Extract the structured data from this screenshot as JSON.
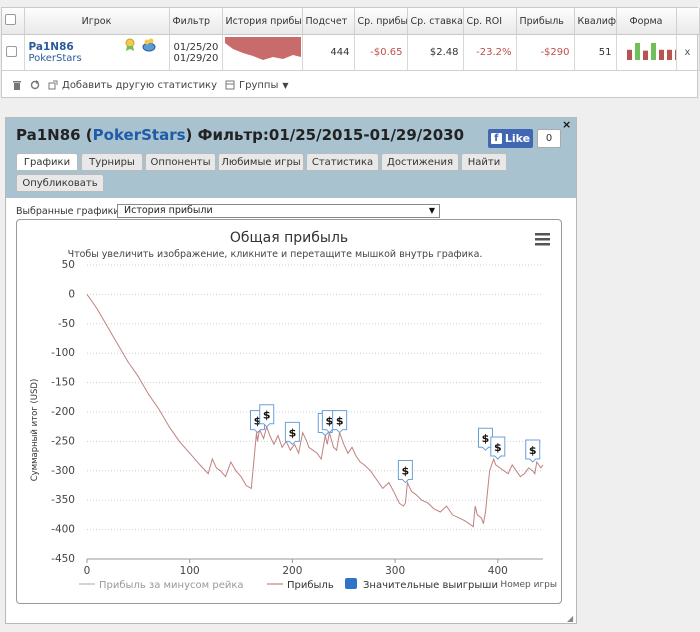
{
  "stats_table": {
    "headers": [
      "Игрок",
      "Фильтр",
      "История прибы",
      "Подсчет",
      "Ср. прибы",
      "Ср. ставка",
      "Ср. ROI",
      "Прибыль",
      "Квалиф",
      "Форма"
    ],
    "row": {
      "player": "Pa1N86",
      "site": "PokerStars",
      "filter_line1": "01/25/20",
      "filter_line2": "01/29/20",
      "count": "444",
      "avg_profit": "-$0.65",
      "avg_stake": "$2.48",
      "avg_roi": "-23.2%",
      "profit": "-$290",
      "qualification": "51",
      "remove": "x"
    },
    "form_bars": [
      {
        "value": 0.6,
        "color": "#b85450"
      },
      {
        "value": 1.0,
        "color": "#6fbf5a"
      },
      {
        "value": 0.55,
        "color": "#b85450"
      },
      {
        "value": 1.0,
        "color": "#6fbf5a"
      },
      {
        "value": 0.6,
        "color": "#b85450"
      },
      {
        "value": 0.6,
        "color": "#b85450"
      },
      {
        "value": 0.6,
        "color": "#b85450"
      }
    ]
  },
  "toolbar": {
    "add_stat_label": "Добавить другую статистику",
    "groups_label": "Группы"
  },
  "panel": {
    "player": "Pa1N86",
    "site": "PokerStars",
    "filter_text": "Фильтр:01/25/2015-01/29/2030",
    "fb_like_label": "Like",
    "fb_count": "0",
    "close_label": "×",
    "tabs": [
      "Графики",
      "Турниры",
      "Оппоненты",
      "Любимые игры",
      "Статистика",
      "Достижения",
      "Найти",
      "Опубликовать"
    ],
    "select_label": "Выбранные графики:",
    "select_value": "История прибыли"
  },
  "colors": {
    "profit_line": "#c0817f",
    "rake_line": "#bbbbbb",
    "big_wins": "#2e75c7",
    "header_bg": "#a8c3cf"
  },
  "chart_data": {
    "type": "line",
    "title": "Общая прибыль",
    "subtitle": "Чтобы увеличить изображение, кликните и перетащите мышкой внутрь графика.",
    "ylabel": "Суммарный итог (USD)",
    "xlabel": "Номер игры",
    "xlim": [
      0,
      444
    ],
    "ylim": [
      -450,
      50
    ],
    "x_ticks": [
      0,
      100,
      200,
      300,
      400
    ],
    "y_ticks": [
      50,
      0,
      -50,
      -100,
      -150,
      -200,
      -250,
      -300,
      -350,
      -400,
      -450
    ],
    "legend": [
      "Прибыль за минусом рейка",
      "Прибыль",
      "Значительные выигрыши"
    ],
    "legend_placement": "bottom",
    "series": [
      {
        "name": "Прибыль",
        "x": [
          0,
          5,
          10,
          20,
          30,
          40,
          50,
          60,
          70,
          80,
          90,
          100,
          110,
          118,
          122,
          126,
          130,
          135,
          140,
          145,
          150,
          155,
          160,
          165,
          166,
          168,
          172,
          175,
          178,
          182,
          186,
          190,
          194,
          198,
          202,
          206,
          210,
          214,
          216,
          220,
          224,
          228,
          232,
          234,
          236,
          240,
          243,
          246,
          250,
          254,
          258,
          262,
          266,
          270,
          276,
          282,
          288,
          294,
          300,
          304,
          308,
          310,
          312,
          316,
          320,
          326,
          332,
          338,
          344,
          350,
          356,
          362,
          368,
          372,
          376,
          378,
          380,
          384,
          386,
          388,
          392,
          396,
          398,
          402,
          406,
          410,
          414,
          418,
          422,
          426,
          430,
          434,
          436,
          438,
          442,
          444
        ],
        "y": [
          0,
          -12,
          -25,
          -55,
          -85,
          -115,
          -140,
          -170,
          -195,
          -225,
          -250,
          -270,
          -290,
          -305,
          -280,
          -295,
          -300,
          -310,
          -285,
          -300,
          -310,
          -325,
          -330,
          -235,
          -250,
          -230,
          -245,
          -225,
          -240,
          -255,
          -240,
          -260,
          -250,
          -265,
          -255,
          -270,
          -235,
          -250,
          -260,
          -265,
          -270,
          -280,
          -240,
          -255,
          -235,
          -260,
          -265,
          -235,
          -255,
          -270,
          -260,
          -275,
          -285,
          -290,
          -300,
          -315,
          -330,
          -320,
          -340,
          -355,
          -360,
          -355,
          -320,
          -335,
          -340,
          -350,
          -355,
          -365,
          -370,
          -360,
          -375,
          -380,
          -385,
          -390,
          -395,
          -360,
          -375,
          -380,
          -390,
          -370,
          -300,
          -280,
          -290,
          -295,
          -300,
          -305,
          -290,
          -300,
          -310,
          -305,
          -295,
          -300,
          -305,
          -285,
          -295,
          -290
        ]
      }
    ],
    "big_win_markers": [
      {
        "x": 166,
        "y": -235
      },
      {
        "x": 175,
        "y": -225
      },
      {
        "x": 200,
        "y": -255
      },
      {
        "x": 232,
        "y": -240
      },
      {
        "x": 236,
        "y": -235
      },
      {
        "x": 246,
        "y": -235
      },
      {
        "x": 310,
        "y": -320
      },
      {
        "x": 388,
        "y": -265
      },
      {
        "x": 400,
        "y": -280
      },
      {
        "x": 434,
        "y": -285
      }
    ],
    "marker_symbol": "$",
    "menu_icon": "hamburger-menu-icon"
  }
}
